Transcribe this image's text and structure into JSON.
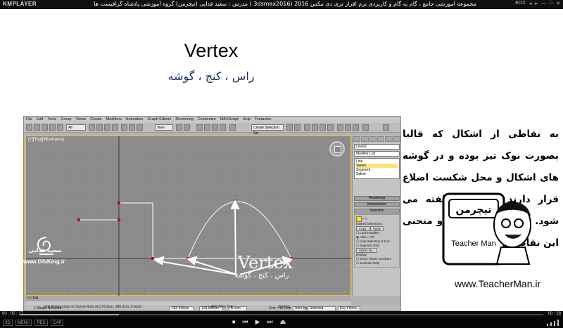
{
  "player": {
    "logo": "KMPLAYER",
    "title": "مجموعه آموزشی جامع ، گام به گام و کاربردی نرم افزار تری دی مکس 2016 (3dsmax2016 ) مدرس : سعید فدایی (تیچرمن) گروه آموزشی پادشاه گرافیست ها",
    "top_controls": [
      "BOX",
      "◂",
      "▸",
      "—",
      "□",
      "✕"
    ],
    "time_elapsed": "00 : 05 : 17",
    "time_total": "00 : 28",
    "progress": 0.19,
    "bottom_left": [
      "3D",
      "MENU",
      "REC",
      "CAP"
    ],
    "bottom_buttons": [
      "⏹",
      "⏮",
      "▶",
      "⏭",
      "⏏"
    ]
  },
  "slide": {
    "title": "Vertex",
    "subtitle": "راس ، کنج ، گوشه",
    "description": "به نقاطی از اشکال که قالبا بصورت نوک تیز بوده و در گوشه های اشکال و محل شکست اضلاع قرار دارند ، ورتکس گفته می شود. ورتکس ها در خط و منحنی این نقاط هستند.",
    "annotation_title": "Vertex",
    "annotation_sub": "راس ، کنج ، گوشه",
    "logo_name": "سعید فدایی",
    "logo_url": "www.GfxKing.ir",
    "teacherman_url": "www.TeacherMan.ir",
    "badge_text": "Teacher Man",
    "badge_fa": "تیچرمن"
  },
  "max": {
    "menu": [
      "File",
      "Edit",
      "Tools",
      "Group",
      "Views",
      "Create",
      "Modifiers",
      "Animation",
      "Graph Editors",
      "Rendering",
      "Customize",
      "MAXScript",
      "Help",
      "Tentacles"
    ],
    "toolbar_dropdown_all": "All",
    "toolbar_dropdown_view": "View",
    "toolbar_selection_set": "Create Selection Set",
    "viewport_label": "[+][Top][Wireframe]",
    "object_name": "Line02",
    "modifier_list": "Modifier List",
    "stack": [
      "Line",
      "Vertex",
      "Segment",
      "Spline"
    ],
    "rollouts": [
      "Rendering",
      "Interpolation",
      "Selection"
    ],
    "named_selections": "Named Selections:",
    "copy": "Copy",
    "paste": "Paste",
    "lock_handles": "Lock Handles",
    "alike": "Alike",
    "all": "All",
    "area_selection": "Area Selection",
    "area_value": "0.1cm",
    "segment_end": "Segment End",
    "select_by": "Select By...",
    "display": "Display",
    "show_vertex_numbers": "Show Vertex Numbers",
    "selected_only": "Selected Only",
    "timeline": "0 / 100",
    "status_selected": "1 Shape Selected",
    "status_prompt": "Grid Points snap on Scene Root at [170.0cm, 180.0cm, 0.0cm]",
    "x_value": "254.408cm",
    "y_value": "128.585cm",
    "z_value": "0.0cm",
    "grid": "Grid = 10.0cm",
    "auto_key": "Auto Key",
    "set_key": "Set Key",
    "key_filters": "Key Filters...",
    "selected_dd": "Selected",
    "add_time_tag": "Add Time Tag"
  }
}
